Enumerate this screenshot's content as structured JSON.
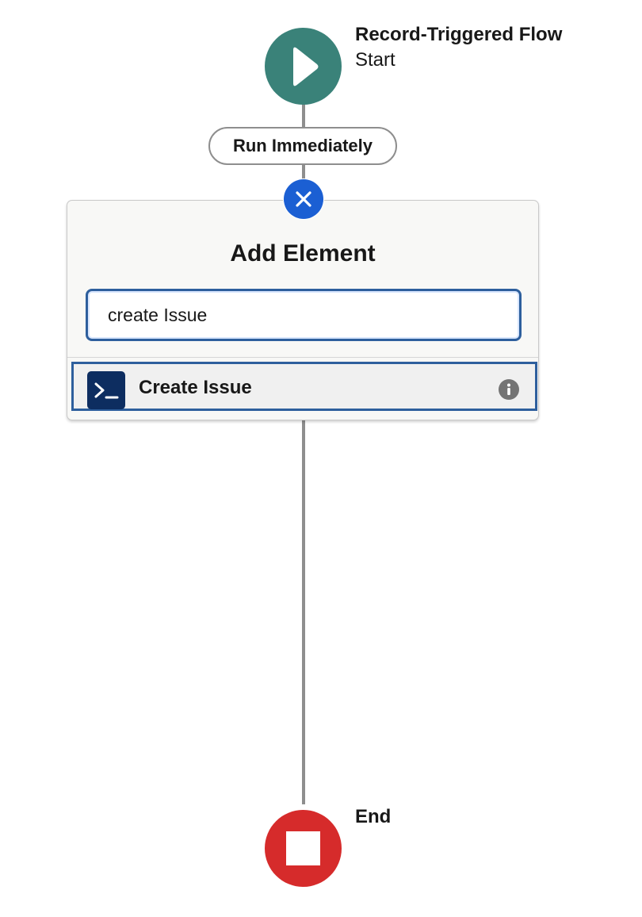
{
  "flow": {
    "start": {
      "title": "Record-Triggered Flow",
      "subtitle": "Start",
      "icon": "play-icon",
      "color": "#3a8279"
    },
    "run_path": {
      "label": "Run Immediately"
    },
    "add_element": {
      "title": "Add Element",
      "search": {
        "value": "create Issue"
      },
      "close_icon": "close-icon",
      "accent_color": "#1b5fd3",
      "results": [
        {
          "label": "Create Issue",
          "icon": "terminal-icon",
          "icon_color": "#0d2d60",
          "info_icon": "info-icon"
        }
      ]
    },
    "end": {
      "label": "End",
      "icon": "stop-icon",
      "color": "#d62b2b"
    }
  }
}
